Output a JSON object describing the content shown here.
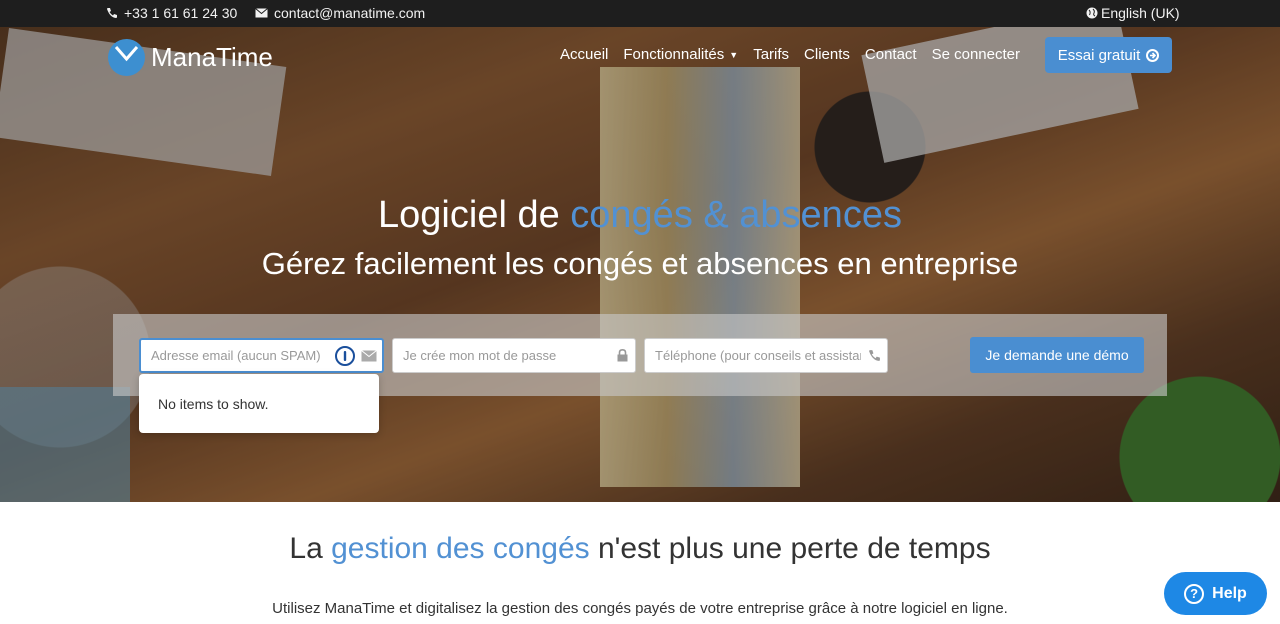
{
  "topbar": {
    "phone": "+33 1 61 61 24 30",
    "email": "contact@manatime.com",
    "language": "English (UK)"
  },
  "brand": {
    "name": "ManaTime"
  },
  "nav": {
    "items": [
      "Accueil",
      "Fonctionnalités",
      "Tarifs",
      "Clients",
      "Contact",
      "Se connecter"
    ],
    "cta": "Essai gratuit"
  },
  "hero": {
    "title_prefix": "Logiciel de ",
    "title_accent": "congés & absences",
    "subtitle": "Gérez facilement les congés et absences en entreprise"
  },
  "form": {
    "email_placeholder": "Adresse email (aucun SPAM)",
    "password_placeholder": "Je crée mon mot de passe",
    "phone_placeholder": "Téléphone (pour conseils et assistance)",
    "submit": "Je demande une démo"
  },
  "autocomplete": {
    "empty_text": "No items to show."
  },
  "section": {
    "title_prefix": "La ",
    "title_accent": "gestion des congés",
    "title_suffix": " n'est plus une perte de temps",
    "text": "Utilisez ManaTime et digitalisez la gestion des congés payés de votre entreprise grâce à notre logiciel en ligne."
  },
  "help": {
    "label": "Help"
  },
  "colors": {
    "accent": "#4a8ed1",
    "topbar": "#1e1e1e",
    "help": "#1e88e5"
  }
}
